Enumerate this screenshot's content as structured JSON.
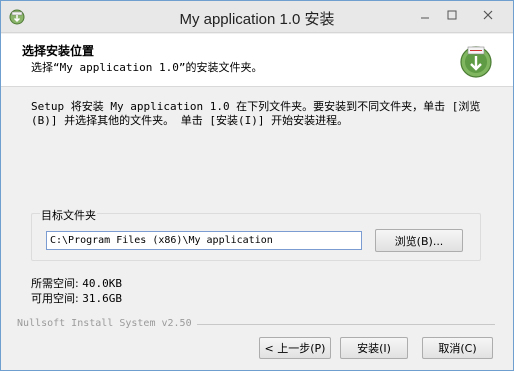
{
  "window": {
    "title": "My application 1.0 安装",
    "icon": "installer-app-icon"
  },
  "header": {
    "title": "选择安装位置",
    "subtitle": "选择“My application 1.0”的安装文件夹。",
    "logo": "installer-globe-icon"
  },
  "body": {
    "description": "Setup 将安装 My application 1.0 在下列文件夹。要安装到不同文件夹，单击 [浏览(B)] 并选择其他的文件夹。 单击 [安装(I)] 开始安装进程。",
    "destination_group_label": "目标文件夹",
    "destination_path": "C:\\Program Files (x86)\\My application",
    "browse_label": "浏览(B)...",
    "space_required_label": "所需空间:",
    "space_required_value": "40.0KB",
    "space_available_label": "可用空间:",
    "space_available_value": "31.6GB"
  },
  "footer": {
    "brand": "Nullsoft Install System v2.50",
    "back_label": "< 上一步(P)",
    "install_label": "安装(I)",
    "cancel_label": "取消(C)"
  },
  "colors": {
    "titlebar": "#e8e8e8",
    "dialog_bg": "#f0f0f0",
    "header_bg": "#ffffff",
    "input_border": "#7a9cd3"
  }
}
